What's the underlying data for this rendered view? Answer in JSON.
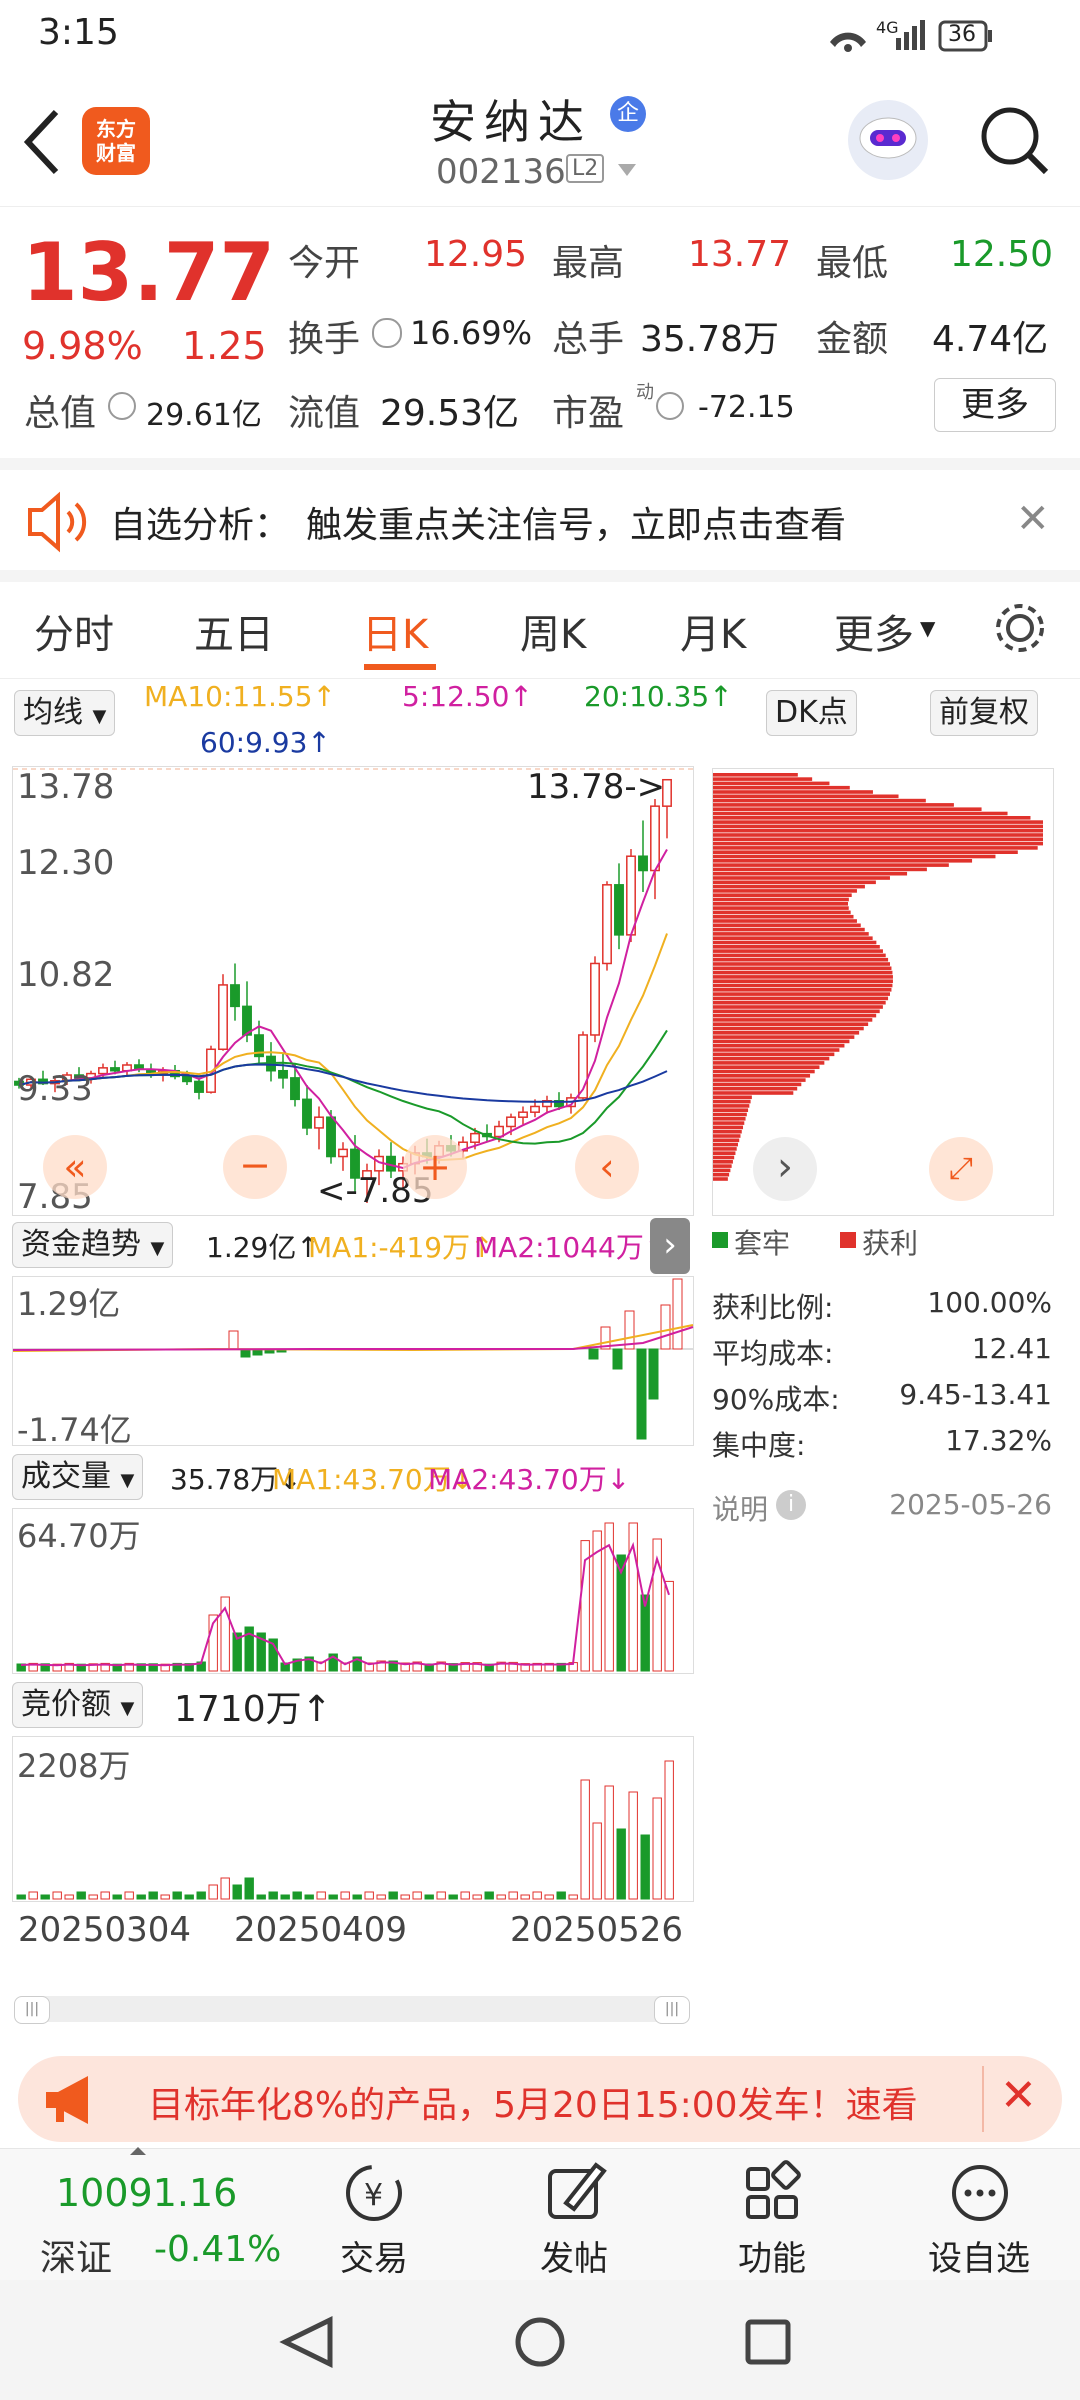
{
  "status": {
    "time": "3:15",
    "network": "4G",
    "battery": "36"
  },
  "header": {
    "back_icon": "back-arrow-icon",
    "logo_line1": "东方",
    "logo_line2": "财富",
    "stock_name": "安纳达",
    "badge": "企",
    "code": "002136",
    "level": "L2"
  },
  "quote": {
    "price": "13.77",
    "change_pct": "9.98%",
    "change": "1.25",
    "open_label": "今开",
    "open": "12.95",
    "high_label": "最高",
    "high": "13.77",
    "low_label": "最低",
    "low": "12.50",
    "turnover_label": "换手",
    "turnover": "16.69%",
    "volume_label": "总手",
    "volume": "35.78万",
    "amount_label": "金额",
    "amount": "4.74亿",
    "mcap_label": "总值",
    "mcap": "29.61亿",
    "float_label": "流值",
    "float_val": "29.53亿",
    "pe_label": "市盈",
    "pe_sup": "动",
    "pe": "-72.15",
    "more": "更多"
  },
  "notice": {
    "title": "自选分析：",
    "text": "触发重点关注信号，立即点击查看"
  },
  "tabs": [
    "分时",
    "五日",
    "日K",
    "周K",
    "月K",
    "更多"
  ],
  "active_tab": "日K",
  "ma_bar": {
    "select": "均线",
    "ma10": "MA10:11.55↑",
    "ma5": "5:12.50↑",
    "ma20": "20:10.35↑",
    "ma60": "60:9.93↑",
    "dk": "DK点",
    "fq": "前复权"
  },
  "kline": {
    "y_labels": [
      "13.78",
      "12.30",
      "10.82",
      "9.33",
      "7.85"
    ],
    "max_tag": "13.78->",
    "min_tag": "<-7.85"
  },
  "chip": {
    "legend_trap": "套牢",
    "legend_profit": "获利",
    "rows": [
      {
        "label": "获利比例:",
        "value": "100.00%"
      },
      {
        "label": "平均成本:",
        "value": "12.41"
      },
      {
        "label": "90%成本:",
        "value": "9.45-13.41"
      },
      {
        "label": "集中度:",
        "value": "17.32%"
      }
    ],
    "note": "说明",
    "date": "2025-05-26"
  },
  "fund": {
    "select": "资金趋势",
    "value": "1.29亿↑",
    "ma1": "MA1:-419万↑",
    "ma2": "MA2:1044万↑",
    "top": "1.29亿",
    "bottom": "-1.74亿"
  },
  "volume": {
    "select": "成交量",
    "value": "35.78万↓",
    "ma1": "MA1:43.70万↓",
    "ma2": "MA2:43.70万↓",
    "top": "64.70万"
  },
  "auction": {
    "select": "竞价额",
    "value": "1710万↑",
    "top": "2208万"
  },
  "dates": [
    "20250304",
    "20250409",
    "20250526"
  ],
  "ad": {
    "text": "目标年化8%的产品，5月20日15:00发车！速看"
  },
  "bottom": {
    "index_value": "10091.16",
    "index_name": "深证",
    "index_change": "-0.41%",
    "trade": "交易",
    "post": "发帖",
    "func": "功能",
    "addwatch": "设自选"
  },
  "colors": {
    "up": "#e0322c",
    "down": "#1a9a2a",
    "ma5": "#d020a0",
    "ma10": "#f0b020",
    "ma20": "#1a9a2a",
    "ma60": "#1a3aa0",
    "brand": "#f05a1e"
  },
  "chart_data": {
    "type": "candlestick",
    "x_ticks": [
      "20250304",
      "20250409",
      "20250526"
    ],
    "ylim": [
      7.85,
      13.78
    ],
    "candles": [
      [
        9.55,
        9.6,
        9.45,
        9.5
      ],
      [
        9.5,
        9.62,
        9.44,
        9.58
      ],
      [
        9.58,
        9.7,
        9.5,
        9.52
      ],
      [
        9.52,
        9.6,
        9.4,
        9.56
      ],
      [
        9.56,
        9.68,
        9.5,
        9.64
      ],
      [
        9.64,
        9.75,
        9.55,
        9.6
      ],
      [
        9.6,
        9.7,
        9.52,
        9.66
      ],
      [
        9.66,
        9.8,
        9.6,
        9.74
      ],
      [
        9.74,
        9.84,
        9.65,
        9.7
      ],
      [
        9.7,
        9.82,
        9.62,
        9.78
      ],
      [
        9.78,
        9.86,
        9.68,
        9.72
      ],
      [
        9.72,
        9.8,
        9.6,
        9.66
      ],
      [
        9.66,
        9.75,
        9.55,
        9.7
      ],
      [
        9.7,
        9.78,
        9.58,
        9.62
      ],
      [
        9.62,
        9.7,
        9.5,
        9.55
      ],
      [
        9.55,
        9.6,
        9.3,
        9.4
      ],
      [
        9.4,
        10.05,
        9.38,
        10.0
      ],
      [
        10.0,
        11.05,
        9.98,
        10.9
      ],
      [
        10.9,
        11.2,
        10.4,
        10.6
      ],
      [
        10.6,
        10.95,
        10.1,
        10.2
      ],
      [
        10.2,
        10.4,
        9.8,
        9.9
      ],
      [
        9.9,
        10.1,
        9.55,
        9.7
      ],
      [
        9.7,
        9.95,
        9.45,
        9.6
      ],
      [
        9.6,
        9.8,
        9.2,
        9.3
      ],
      [
        9.3,
        9.5,
        8.8,
        8.9
      ],
      [
        8.9,
        9.2,
        8.6,
        9.05
      ],
      [
        9.05,
        9.15,
        8.4,
        8.5
      ],
      [
        8.5,
        8.7,
        8.3,
        8.6
      ],
      [
        8.6,
        8.8,
        8.0,
        8.2
      ],
      [
        8.2,
        8.4,
        7.85,
        8.3
      ],
      [
        8.3,
        8.6,
        8.1,
        8.5
      ],
      [
        8.5,
        8.7,
        8.2,
        8.3
      ],
      [
        8.3,
        8.5,
        8.05,
        8.4
      ],
      [
        8.4,
        8.65,
        8.25,
        8.55
      ],
      [
        8.55,
        8.75,
        8.4,
        8.5
      ],
      [
        8.5,
        8.72,
        8.4,
        8.65
      ],
      [
        8.65,
        8.8,
        8.5,
        8.58
      ],
      [
        8.58,
        8.78,
        8.48,
        8.7
      ],
      [
        8.7,
        8.9,
        8.6,
        8.82
      ],
      [
        8.82,
        8.95,
        8.7,
        8.78
      ],
      [
        8.78,
        9.0,
        8.7,
        8.92
      ],
      [
        8.92,
        9.1,
        8.8,
        9.05
      ],
      [
        9.05,
        9.2,
        8.95,
        9.12
      ],
      [
        9.12,
        9.3,
        9.05,
        9.2
      ],
      [
        9.2,
        9.35,
        9.1,
        9.28
      ],
      [
        9.28,
        9.4,
        9.15,
        9.2
      ],
      [
        9.2,
        9.38,
        9.1,
        9.32
      ],
      [
        9.32,
        10.25,
        9.3,
        10.2
      ],
      [
        10.2,
        11.3,
        10.1,
        11.2
      ],
      [
        11.2,
        12.35,
        11.1,
        12.3
      ],
      [
        12.3,
        12.6,
        11.4,
        11.6
      ],
      [
        11.6,
        12.8,
        11.5,
        12.7
      ],
      [
        12.7,
        13.2,
        12.2,
        12.5
      ],
      [
        12.5,
        13.5,
        12.1,
        13.4
      ],
      [
        13.4,
        13.78,
        12.95,
        13.77
      ]
    ]
  }
}
